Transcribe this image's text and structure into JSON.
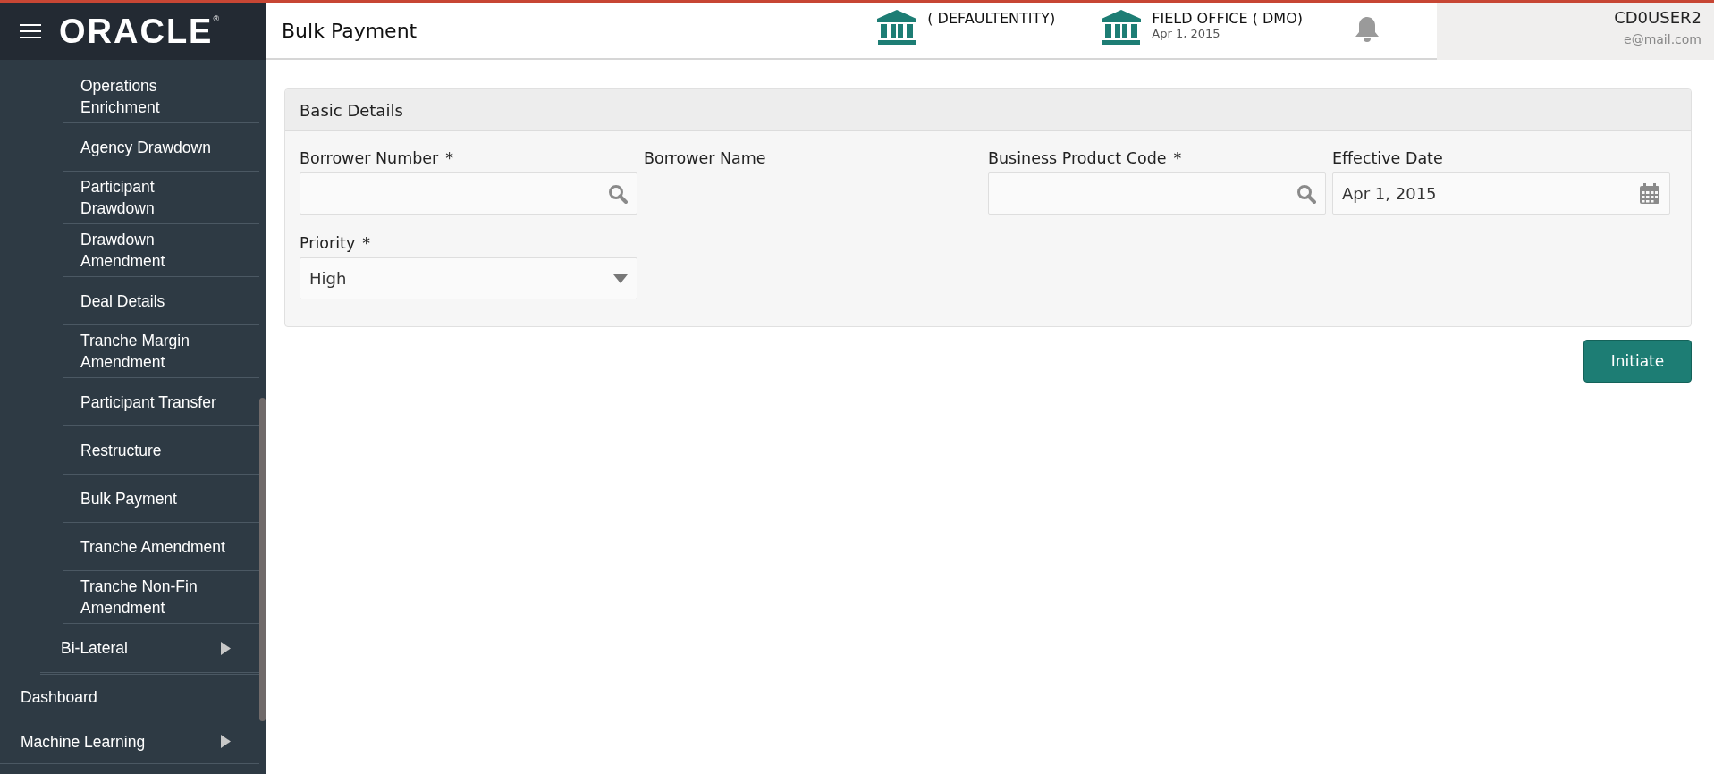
{
  "header": {
    "logo": "ORACLE",
    "logo_mark": "®",
    "page_title": "Bulk Payment",
    "entity": {
      "name": "( DEFAULTENTITY)"
    },
    "branch": {
      "name": "FIELD OFFICE  ( DMO)",
      "date": "Apr 1, 2015"
    },
    "user": {
      "name": "CD0USER2",
      "email": "e@mail.com"
    }
  },
  "sidebar": {
    "items": [
      {
        "children": [
          {
            "children": [
              {
                "label": "Operations Enrichment"
              },
              {
                "label": "Agency Drawdown"
              },
              {
                "label": "Participant Drawdown"
              },
              {
                "label": "Drawdown Amendment"
              },
              {
                "label": "Deal Details"
              },
              {
                "label": "Tranche Margin Amendment"
              },
              {
                "label": "Participant Transfer"
              },
              {
                "label": "Restructure"
              },
              {
                "label": "Bulk Payment"
              },
              {
                "label": "Tranche Amendment"
              },
              {
                "label": "Tranche Non-Fin Amendment"
              }
            ]
          },
          {
            "label": "Bi-Lateral",
            "expandable": true
          }
        ]
      },
      {
        "label": "Dashboard",
        "expandable": false
      },
      {
        "label": "Machine Learning",
        "expandable": true
      }
    ]
  },
  "form": {
    "title": "Basic Details",
    "fields": [
      {
        "kind": "lookup",
        "label": "Borrower Number",
        "required_mark": "*"
      },
      {
        "kind": "display",
        "label": "Borrower Name"
      },
      {
        "kind": "lookup",
        "label": "Business Product Code",
        "required_mark": "*"
      },
      {
        "kind": "date",
        "label": "Effective Date",
        "value": "Apr 1, 2015"
      },
      {
        "kind": "select",
        "label": "Priority",
        "required_mark": "*",
        "value": "High"
      }
    ]
  },
  "actions": [
    {
      "label": "Initiate"
    }
  ]
}
